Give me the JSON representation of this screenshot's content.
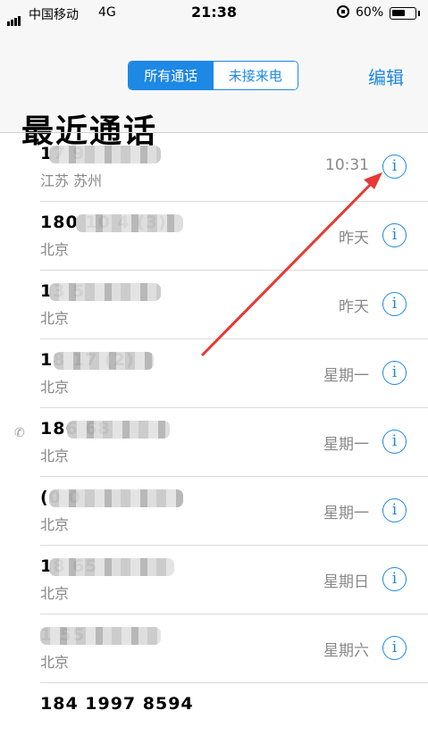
{
  "status_bar": {
    "carrier": "中国移动",
    "network": "4G",
    "time": "21:38",
    "battery": "60%",
    "battery_level": 0.6
  },
  "nav": {
    "segments": [
      "所有通话",
      "未接来电"
    ],
    "selected_segment": "所有通话",
    "edit_label": "编辑",
    "title": "最近通话"
  },
  "calls": [
    {
      "number": "17          9",
      "location": "江苏 苏州",
      "time": "10:31"
    },
    {
      "number": "180 10        4 (3)",
      "location": "北京",
      "time": "昨天"
    },
    {
      "number": "13            5",
      "location": "北京",
      "time": "昨天"
    },
    {
      "number": "18           17 (2)",
      "location": "北京",
      "time": "星期一"
    },
    {
      "number": "186          68",
      "location": "北京",
      "time": "星期一"
    },
    {
      "number": "(0           0",
      "location": "北京",
      "time": "星期一"
    },
    {
      "number": "18           65",
      "location": "北京",
      "time": "星期日"
    },
    {
      "number": "1            55",
      "location": "北京",
      "time": "星期六"
    },
    {
      "number": "184 1997 8594",
      "location": "",
      "time": ""
    }
  ],
  "info_glyph": "i",
  "phone_glyph": "✆",
  "colors": {
    "accent": "#1e88e5",
    "annotation_arrow": "#e53935"
  }
}
